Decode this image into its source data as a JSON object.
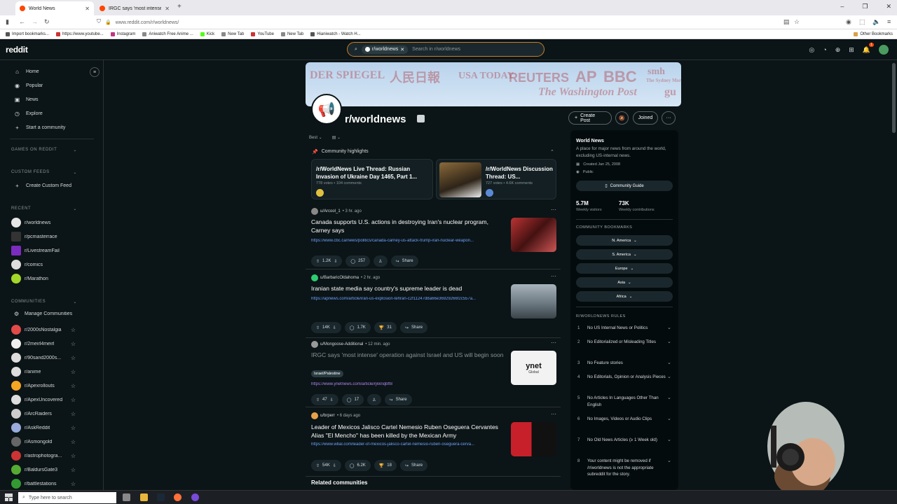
{
  "browser": {
    "tabs": [
      {
        "title": "World News",
        "active": true
      },
      {
        "title": "IRGC says 'most intense' operati",
        "active": false
      }
    ],
    "new_tab": "+",
    "url": "www.reddit.com/r/worldnews/",
    "bookmarks": [
      "Import bookmarks...",
      "https://www.youtube...",
      "Instagram",
      "Aniwatch Free Anime ...",
      "Kick",
      "New Tab",
      "YouTube",
      "New Tab",
      "Hianiwatch - Watch H..."
    ],
    "other_bookmarks": "Other Bookmarks"
  },
  "reddit": {
    "logo": "reddit",
    "search_chip": "r/worldnews",
    "search_placeholder": "Search in r/worldnews",
    "notif_count": "1"
  },
  "leftnav": {
    "main": [
      {
        "label": "Home",
        "icon": "home-icon"
      },
      {
        "label": "Popular",
        "icon": "popular-icon"
      },
      {
        "label": "News",
        "icon": "news-icon"
      },
      {
        "label": "Explore",
        "icon": "explore-icon"
      },
      {
        "label": "Start a community",
        "icon": "plus-icon"
      }
    ],
    "games_header": "GAMES ON REDDIT",
    "custom_feeds_header": "CUSTOM FEEDS",
    "create_custom_feed": "Create Custom Feed",
    "recent_header": "RECENT",
    "recent": [
      "r/worldnews",
      "r/pcmasterrace",
      "r/LivestreamFail",
      "r/comics",
      "r/Marathon"
    ],
    "communities_header": "COMMUNITIES",
    "manage": "Manage Communities",
    "communities": [
      "r/2000sNostalgia",
      "r/2meirl4meirl",
      "r/90sand2000s...",
      "r/anime",
      "r/Apexrollouts",
      "r/ApexUncovered",
      "r/ArcRaiders",
      "r/AskReddit",
      "r/Asmongold",
      "r/astrophotogra...",
      "r/BaldursGate3",
      "r/battlestations"
    ]
  },
  "banner_words": [
    "DER SPIEGEL",
    "人民日報",
    "USA TODAY",
    "REUTERS",
    "AP",
    "BBC",
    "The Washington Post",
    "smh",
    "The Sydney Morn",
    "gu"
  ],
  "community": {
    "name": "r/worldnews",
    "create_post": "Create Post",
    "joined": "Joined",
    "sort": "Best",
    "highlights_title": "Community highlights",
    "highlights": [
      {
        "title": "/r/WorldNews Live Thread: Russian Invasion of Ukraine Day 1465, Part 1...",
        "meta": "778 votes • 104 comments"
      },
      {
        "title": "/r/WorldNews Discussion Thread: US...",
        "meta": "727 votes • 4.6K comments"
      }
    ]
  },
  "posts": [
    {
      "user": "u/Arcool_1",
      "time": "• 3 hr. ago",
      "title": "Canada supports U.S. actions in destroying Iran's nuclear program, Carney says",
      "link": "https://www.cbc.ca/news/politics/canada-carney-us-attack-trump-iran-nuclear-weapon...",
      "votes": "1.2K",
      "comments": "257",
      "awards": "",
      "share": "Share"
    },
    {
      "user": "u/BarbaricOldahoma",
      "time": "• 2 hr. ago",
      "title": "Iranian state media say country's supreme leader is dead",
      "link": "https://apnews.com/article/iran-us-explosion-tehran-c2f11247d8a66e36929266f2c557a...",
      "votes": "14K",
      "comments": "1.7K",
      "awards": "31",
      "share": "Share"
    },
    {
      "user": "u/Mongoose-Additional",
      "time": "• 12 min. ago",
      "title": "IRGC says 'most intense' operation against Israel and US will begin soon",
      "flair": "Israel/Palestine",
      "link": "https://www.ynetnews.com/article/rjkknqbff8",
      "votes": "47",
      "comments": "17",
      "awards": "",
      "share": "Share",
      "thumb_text": "ynet",
      "thumb_sub": "Global"
    },
    {
      "user": "u/brperr",
      "time": "• 6 days ago",
      "title": "Leader of Mexicos Jalisco Cartel Nemesio Ruben Oseguera Cervantes Alias \"El Mencho\" has been killed by the Mexican Army",
      "link": "https://www.wbal.com/leader-of-mexicos-jalisco-cartel-nemesio-ruben-oseguera-cerva...",
      "votes": "54K",
      "comments": "6.2K",
      "awards": "18",
      "share": "Share"
    }
  ],
  "related": "Related communities",
  "sidebar": {
    "title": "World News",
    "desc": "A place for major news from around the world, excluding US-internal news.",
    "created": "Created Jan 25, 2008",
    "visibility": "Public",
    "guide": "Community Guide",
    "visitors": "5.7M",
    "visitors_label": "Weekly visitors",
    "contribs": "73K",
    "contribs_label": "Weekly contributions",
    "bookmarks_header": "COMMUNITY BOOKMARKS",
    "bookmarks": [
      "N. America",
      "S. America",
      "Europe",
      "Asia",
      "Africa"
    ],
    "rules_header": "R/WORLDNEWS RULES",
    "rules": [
      {
        "n": "1",
        "t": "No US Internal News or Politics"
      },
      {
        "n": "2",
        "t": "No Editorialized or Misleading Titles"
      },
      {
        "n": "3",
        "t": "No Feature stories"
      },
      {
        "n": "4",
        "t": "No Editorials, Opinion or Analysis Pieces"
      },
      {
        "n": "5",
        "t": "No Articles In Languages Other Than English"
      },
      {
        "n": "6",
        "t": "No Images, Videos or Audio Clips"
      },
      {
        "n": "7",
        "t": "No Old News Articles (≥ 1 Week old)"
      },
      {
        "n": "8",
        "t": "Your content might be removed if /r/worldnews is not the appropriate subreddit for the story."
      }
    ]
  },
  "taskbar": {
    "search": "Type here to search"
  }
}
